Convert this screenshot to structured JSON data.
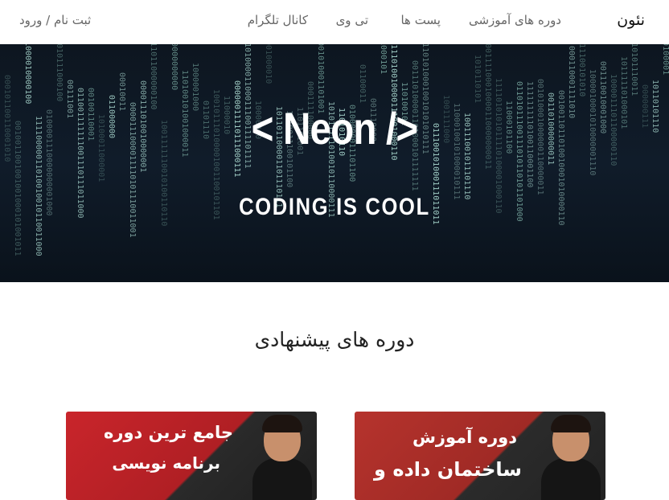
{
  "navbar": {
    "brand": "نئون",
    "links": [
      "دوره های آموزشی",
      "پست ها",
      "تی وی",
      "کانال تلگرام"
    ],
    "auth": "ثبت نام / ورود"
  },
  "hero": {
    "title": "< Neon />",
    "subtitle": "CODING IS COOL"
  },
  "section": {
    "title": "دوره های پیشنهادی"
  },
  "cards": [
    {
      "line1": "جامع ترین دوره",
      "line2": "برنامه نویسی"
    },
    {
      "line1": "دوره آموزش",
      "line2": "ساختمان داده و"
    }
  ]
}
